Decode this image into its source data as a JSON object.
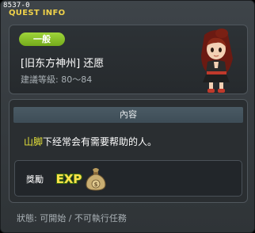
{
  "window": {
    "quest_id": "8537-0",
    "title": "QUEST INFO"
  },
  "quest": {
    "category": "一般",
    "name": "[旧东方神州] 还愿",
    "level_range": "建議等級: 80～84"
  },
  "content": {
    "header": "內容",
    "description_highlight": "山脚",
    "description_rest": "下经常会有需要帮助的人。"
  },
  "reward": {
    "label": "獎勵",
    "icons": [
      "exp-icon",
      "money-bag-icon"
    ]
  },
  "status": {
    "text": "狀態:  可開始 / 不可執行任務"
  },
  "colors": {
    "title": "#f0d24a",
    "badge": "#8cc62d",
    "highlight": "#e7e43a",
    "header_bar": "#44535d"
  }
}
